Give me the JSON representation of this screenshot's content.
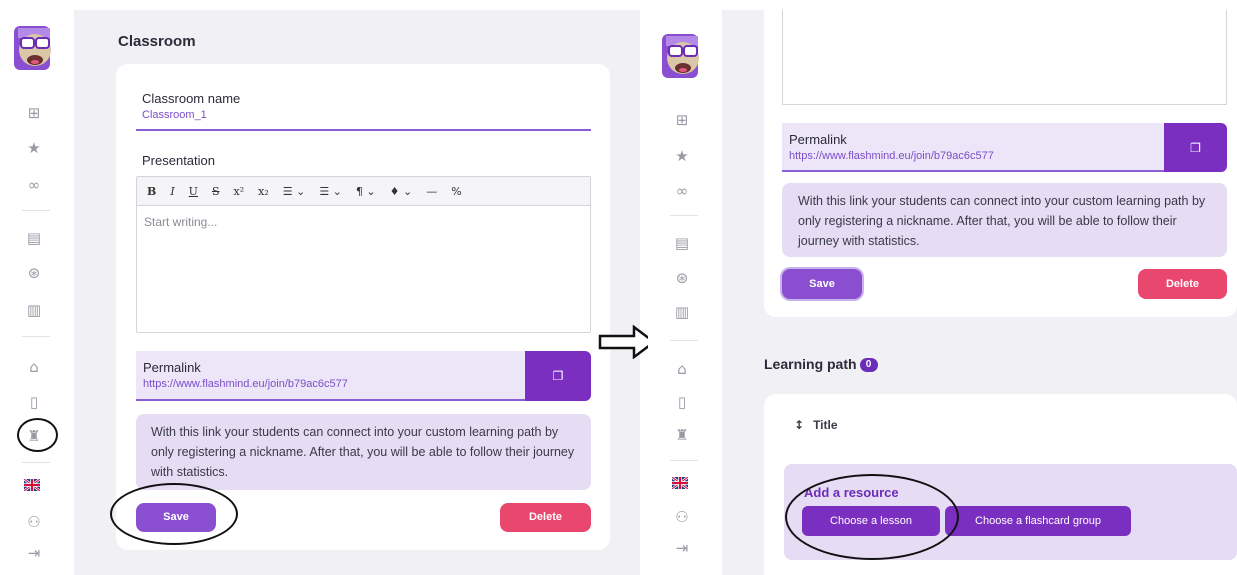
{
  "left": {
    "page_title": "Classroom",
    "classroom_name_label": "Classroom name",
    "classroom_name_value": "Classroom_1",
    "presentation_label": "Presentation",
    "toolbar": [
      "B",
      "I",
      "U",
      "S",
      "x²",
      "x₂",
      "☰ ⌄",
      "☰ ⌄",
      "¶ ⌄",
      "♦ ⌄",
      "—",
      "%"
    ],
    "editor_placeholder": "Start writing...",
    "permalink_label": "Permalink",
    "permalink_url": "https://www.flashmind.eu/join/b79ac6c577",
    "info_text": "With this link your students can connect into your custom learning path by only registering a nickname. After that, you will be able to follow their journey with statistics.",
    "save_label": "Save",
    "delete_label": "Delete"
  },
  "right": {
    "permalink_label": "Permalink",
    "permalink_url": "https://www.flashmind.eu/join/b79ac6c577",
    "info_text": "With this link your students can connect into your custom learning path by only registering a nickname. After that, you will be able to follow their journey with statistics.",
    "save_label": "Save",
    "delete_label": "Delete",
    "learning_path_title": "Learning path",
    "learning_path_count": "0",
    "title_column": "Title",
    "add_resource_label": "Add a resource",
    "choose_lesson_label": "Choose a lesson",
    "choose_flashcard_label": "Choose a flashcard group"
  },
  "sidebar_icons": [
    "dashboard-icon",
    "star-icon",
    "binoculars-icon",
    "document-icon",
    "globe-icon",
    "book-icon",
    "graduation-cap-icon",
    "exit-door-icon",
    "school-icon",
    "uk-flag-icon",
    "user-settings-icon",
    "logout-icon"
  ],
  "colors": {
    "primary": "#7a2fc0",
    "accent_light": "#e6dcf4",
    "danger": "#e9476e",
    "link": "#7c4dc8"
  }
}
